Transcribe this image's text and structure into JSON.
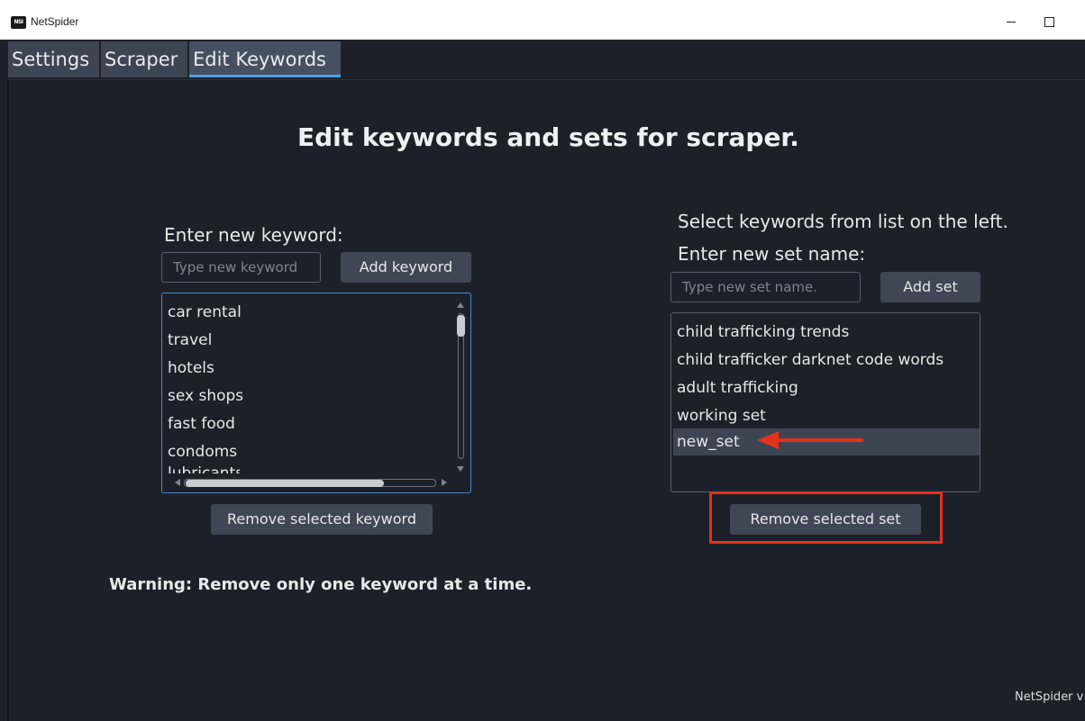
{
  "window": {
    "icon_text": "NSI",
    "title": "NetSpider"
  },
  "tabs": [
    {
      "label": "Settings"
    },
    {
      "label": "Scraper"
    },
    {
      "label": "Edit Keywords"
    }
  ],
  "page": {
    "heading": "Edit keywords and sets for scraper."
  },
  "keywords": {
    "label": "Enter new keyword:",
    "input_placeholder": "Type new keyword",
    "add_label": "Add keyword",
    "items": [
      "car rental",
      "travel",
      "hotels",
      "sex shops",
      "fast food",
      "condoms"
    ],
    "partial_item": "lubricants",
    "remove_label": "Remove selected keyword"
  },
  "sets": {
    "instruction": "Select keywords from list on the left.",
    "label": "Enter new set name:",
    "input_placeholder": "Type new set name.",
    "add_label": "Add set",
    "items": [
      "child trafficking trends",
      "child trafficker darknet code words",
      "adult trafficking",
      "working set",
      "new_set"
    ],
    "selected_index": 4,
    "remove_label": "Remove selected set"
  },
  "warning": "Warning: Remove only one keyword at a time.",
  "footer": {
    "version": "NetSpider v"
  },
  "annotation": {
    "color": "#e5301c"
  }
}
